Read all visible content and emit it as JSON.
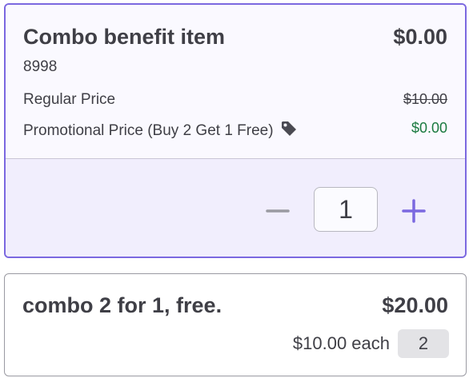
{
  "items": [
    {
      "name": "Combo benefit item",
      "total": "$0.00",
      "sku": "8998",
      "regular_label": "Regular Price",
      "regular_value": "$10.00",
      "promo_label": "Promotional Price (Buy 2 Get 1 Free)",
      "promo_value": "$0.00",
      "promo_icon": "tag-icon",
      "quantity": "1",
      "selected": true
    },
    {
      "name": "combo 2 for 1, free.",
      "total": "$20.00",
      "each": "$10.00 each",
      "quantity": "2",
      "selected": false
    }
  ],
  "colors": {
    "accent": "#7b68e0",
    "promo_green": "#1a7a3f",
    "text": "#3f3f46"
  }
}
